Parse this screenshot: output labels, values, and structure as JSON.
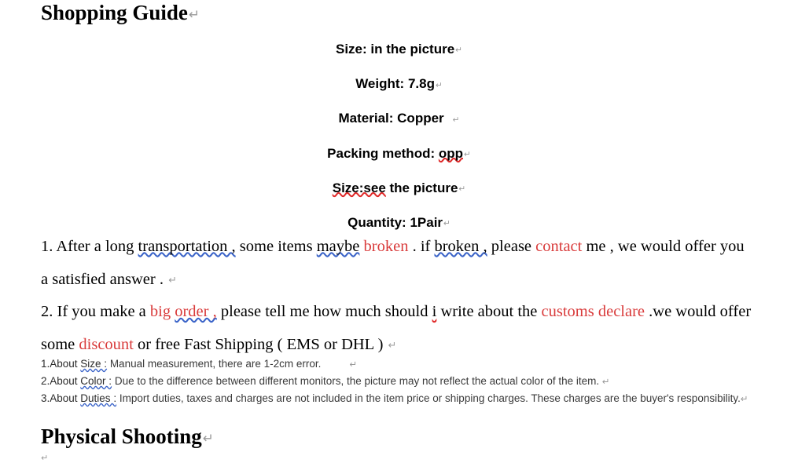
{
  "document": {
    "headings": {
      "shopping_guide": "Shopping Guide",
      "physical_shooting": "Physical Shooting"
    },
    "marks": {
      "carriage_return": "↵"
    },
    "colors": {
      "text": "#000000",
      "highlight_red": "#D93B3B",
      "spellcheck_red": "#E02A2A",
      "grammar_blue": "#3A63C8",
      "note_text": "#3A3A3A",
      "mark_gray": "#9A9A9A",
      "background": "#FFFFFF"
    },
    "specs": [
      {
        "label": "Size:",
        "value": "in the picture"
      },
      {
        "label": "Weight:",
        "value": "7.8g"
      },
      {
        "label": "Material:",
        "value": "Copper"
      },
      {
        "label": "Packing method:",
        "value": "opp"
      },
      {
        "label": "Size:see",
        "value": "the picture"
      },
      {
        "label": "Quantity:",
        "value": "1Pair"
      }
    ],
    "spec_lines": [
      "Size: in the picture",
      "Weight: 7.8g",
      "Material: Copper ",
      "Packing method: opp",
      "Size:see the picture",
      "Quantity: 1Pair"
    ],
    "paragraph_1": {
      "number": "1.",
      "seg_a": " After a long ",
      "seg_transportation": "transportation ,",
      "seg_b": " some items ",
      "seg_maybe": "maybe",
      "seg_c": " ",
      "seg_broken": "broken",
      "seg_d": " . if ",
      "seg_if_broken": "broken ,",
      "seg_e": " please ",
      "seg_contact": "contact",
      "seg_f": " me , we would offer you",
      "line2": "a satisfied answer . "
    },
    "paragraph_2": {
      "number": "2.",
      "seg_a": " If you make a ",
      "seg_big": "big ",
      "seg_order": "order ,",
      "seg_b": " please tell me how much should ",
      "seg_i": "i",
      "seg_c": " write about the ",
      "seg_customs": "customs declare",
      "seg_d": " .we would offer",
      "line2_a": "some ",
      "line2_discount": "discount",
      "line2_b": " or free Fast Shipping ( EMS or DHL ) "
    },
    "notes": [
      {
        "lead": "1.About ",
        "topic": "Size :",
        "body": " Manual measurement, there are 1-2cm error."
      },
      {
        "lead": "2.About ",
        "topic": "Color :",
        "body": " Due to the difference between different monitors, the picture may not reflect the actual color of the item. "
      },
      {
        "lead": "3.About ",
        "topic": "Duties :",
        "body": " Import duties, taxes and charges are not included in the item price or shipping charges. These charges are the buyer's responsibility."
      }
    ]
  }
}
